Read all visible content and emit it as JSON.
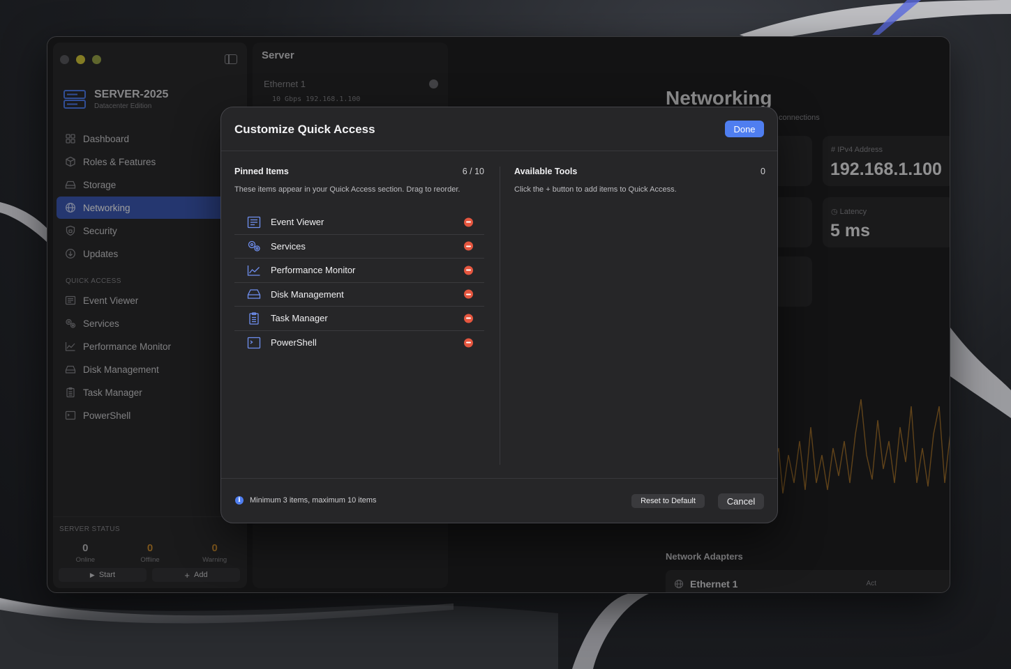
{
  "sidebar": {
    "brand_title": "SERVER-2025",
    "brand_subtitle": "Datacenter Edition",
    "nav": [
      {
        "label": "Dashboard"
      },
      {
        "label": "Roles & Features"
      },
      {
        "label": "Storage"
      },
      {
        "label": "Networking"
      },
      {
        "label": "Security"
      },
      {
        "label": "Updates"
      }
    ],
    "active_nav": "Networking",
    "quick_access_label": "QUICK ACCESS",
    "quick_access": [
      {
        "label": "Event Viewer"
      },
      {
        "label": "Services"
      },
      {
        "label": "Performance Monitor"
      },
      {
        "label": "Disk Management"
      },
      {
        "label": "Task Manager"
      },
      {
        "label": "PowerShell"
      }
    ],
    "server_status": {
      "label": "SERVER STATUS",
      "online": {
        "value": "0",
        "caption": "Online"
      },
      "offline": {
        "value": "0",
        "caption": "Offline"
      },
      "warning": {
        "value": "0",
        "caption": "Warning"
      },
      "start_label": "Start",
      "add_label": "Add"
    }
  },
  "middle": {
    "title": "Server",
    "adapter_name": "Ethernet 1",
    "adapter_meta": "10 Gbps  192.168.1.100"
  },
  "content": {
    "title": "Networking",
    "subtitle": "connections",
    "ipv4_label": "IPv4 Address",
    "ipv4_value": "192.168.1.100",
    "latency_label": "Latency",
    "latency_value": "5 ms",
    "network_adapters_label": "Network Adapters",
    "adapter_row_name": "Ethernet 1",
    "adapter_row_status": "Act"
  },
  "modal": {
    "title": "Customize Quick Access",
    "done_label": "Done",
    "pinned_title": "Pinned Items",
    "pinned_count": "6 / 10",
    "pinned_desc": "These items appear in your Quick Access section. Drag to reorder.",
    "pinned_items": [
      {
        "label": "Event Viewer",
        "icon": "list-icon"
      },
      {
        "label": "Services",
        "icon": "gears-icon"
      },
      {
        "label": "Performance Monitor",
        "icon": "chart-icon"
      },
      {
        "label": "Disk Management",
        "icon": "disk-icon"
      },
      {
        "label": "Task Manager",
        "icon": "clipboard-icon"
      },
      {
        "label": "PowerShell",
        "icon": "terminal-icon"
      }
    ],
    "available_title": "Available Tools",
    "available_count": "0",
    "available_desc": "Click the + button to add items to Quick Access.",
    "footer_info": "Minimum 3 items, maximum 10 items",
    "reset_label": "Reset to Default",
    "cancel_label": "Cancel"
  },
  "colors": {
    "accent": "#4f7ef0",
    "active_nav": "#3d5ab5",
    "remove": "#e5563f",
    "offline": "#c98a2e",
    "chart_line": "#c98a2e"
  }
}
